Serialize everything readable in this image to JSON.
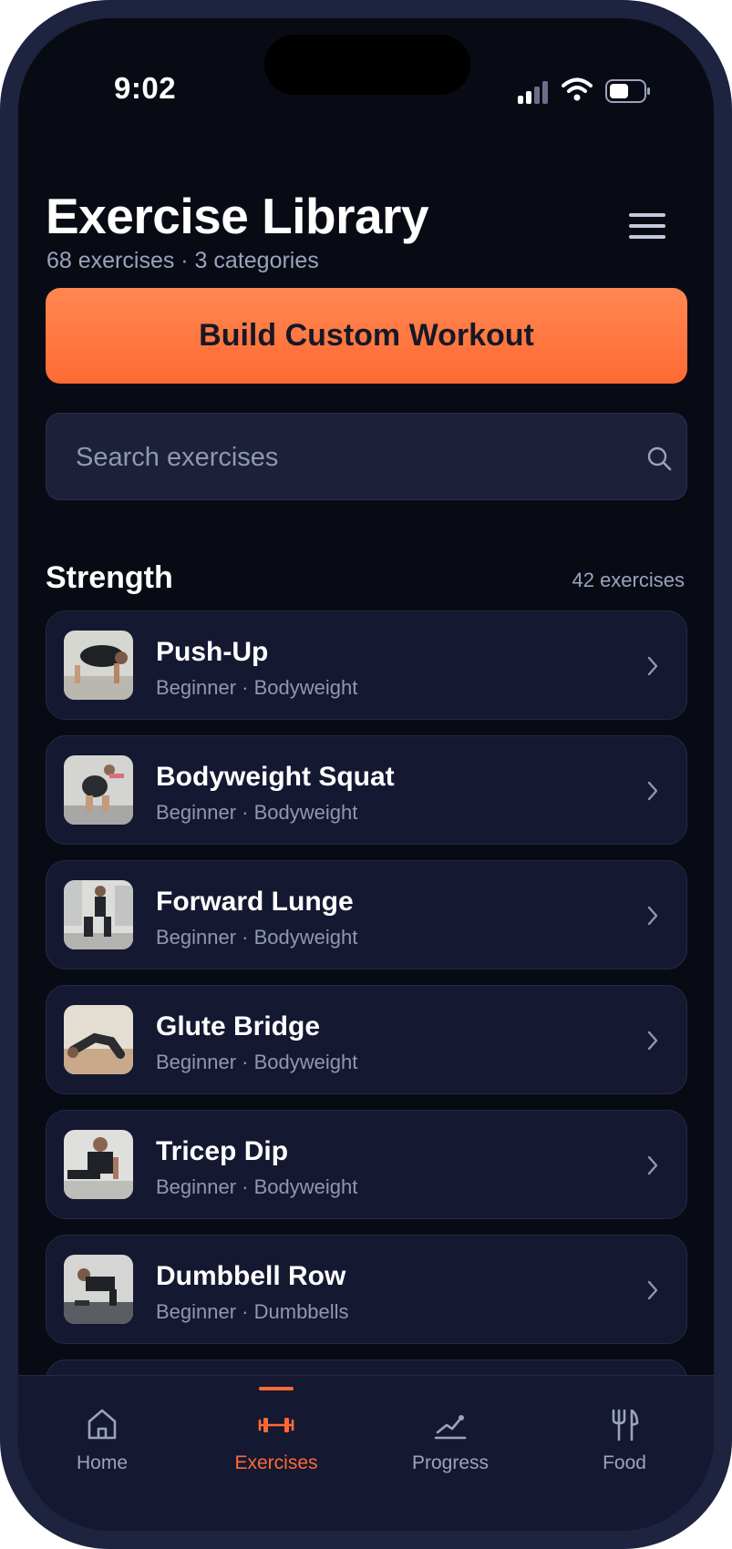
{
  "status": {
    "time": "9:02"
  },
  "header": {
    "title": "Exercise Library",
    "subtitle": "68 exercises · 3 categories"
  },
  "cta_label": "Build Custom Workout",
  "search": {
    "placeholder": "Search exercises"
  },
  "section": {
    "title": "Strength",
    "count": "42 exercises"
  },
  "exercises": [
    {
      "name": "Push-Up",
      "meta": "Beginner · Bodyweight"
    },
    {
      "name": "Bodyweight Squat",
      "meta": "Beginner · Bodyweight"
    },
    {
      "name": "Forward Lunge",
      "meta": "Beginner · Bodyweight"
    },
    {
      "name": "Glute Bridge",
      "meta": "Beginner · Bodyweight"
    },
    {
      "name": "Tricep Dip",
      "meta": "Beginner · Bodyweight"
    },
    {
      "name": "Dumbbell Row",
      "meta": "Beginner · Dumbbells"
    }
  ],
  "tabs": [
    {
      "label": "Home",
      "icon": "home-icon",
      "active": false
    },
    {
      "label": "Exercises",
      "icon": "dumbbell-icon",
      "active": true
    },
    {
      "label": "Progress",
      "icon": "chart-icon",
      "active": false
    },
    {
      "label": "Food",
      "icon": "utensils-icon",
      "active": false
    }
  ],
  "colors": {
    "accent": "#ff6a33",
    "background": "#090b14",
    "card": "#151831",
    "frame": "#1e2340"
  }
}
